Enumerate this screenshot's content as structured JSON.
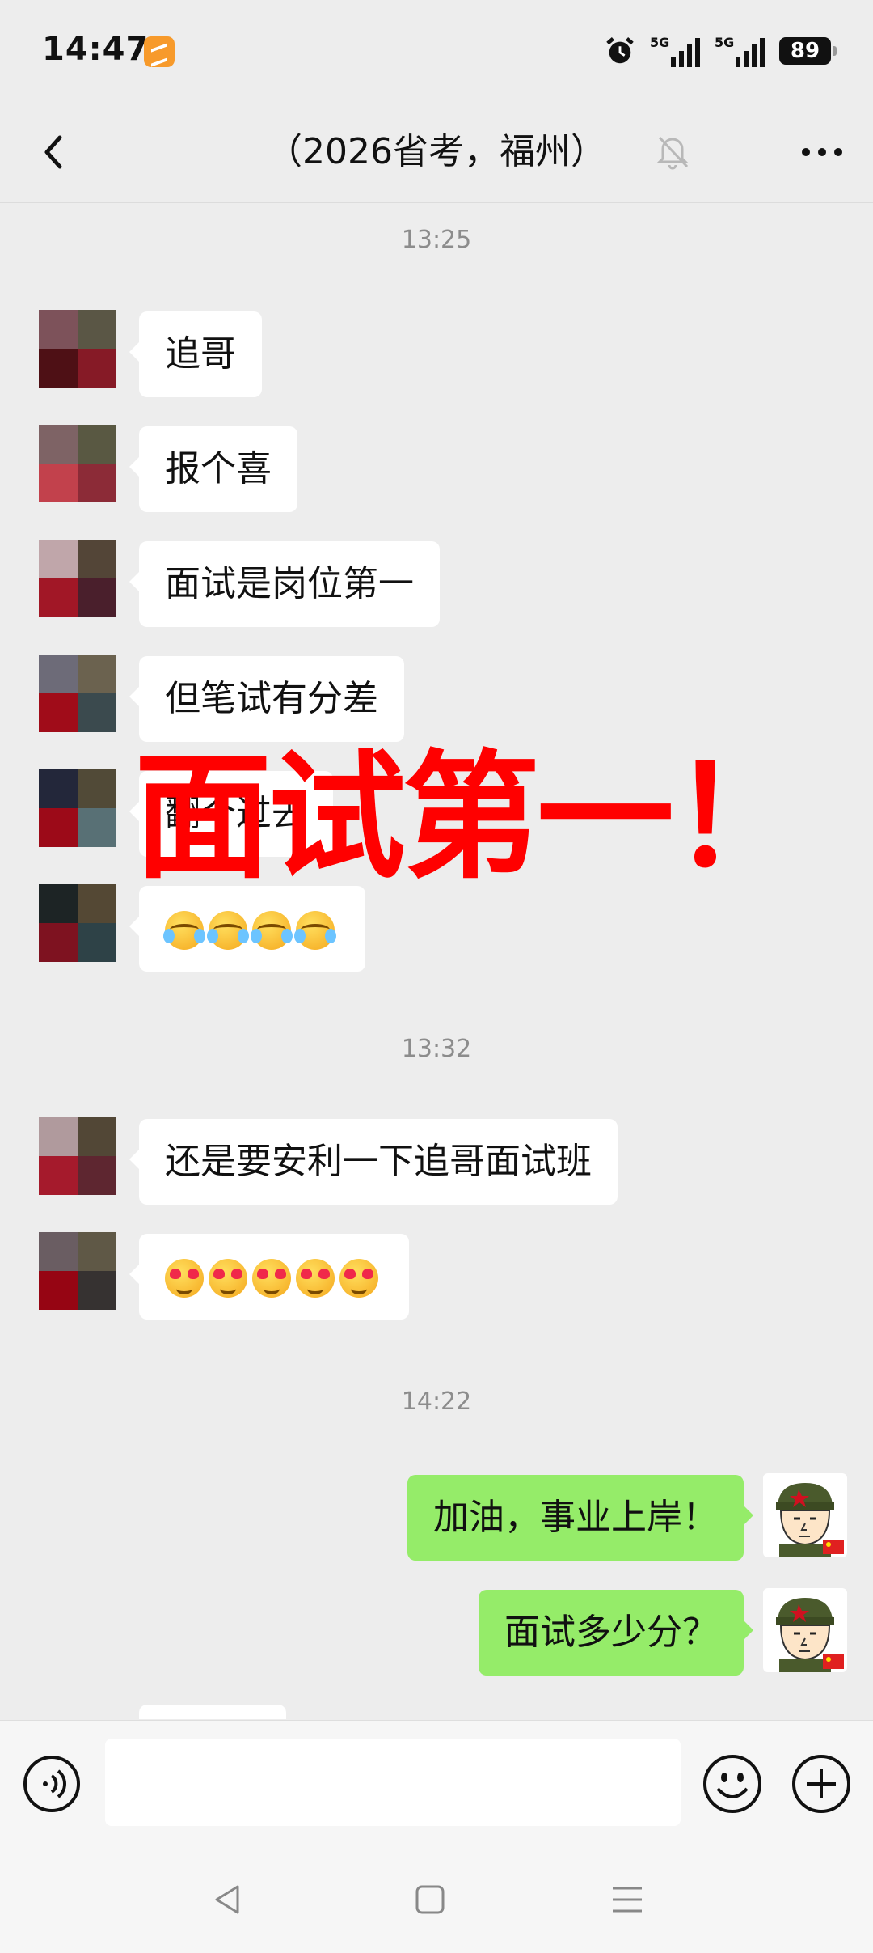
{
  "status_bar": {
    "time": "14:47",
    "signal1_label": "5G",
    "signal2_label": "5G",
    "battery": "89"
  },
  "nav": {
    "title": "（2026省考，福州）",
    "back_icon": "chevron-left-icon",
    "mute_icon": "bell-off-icon",
    "more_icon": "more-horizontal-icon"
  },
  "chat": {
    "timestamps": [
      "13:25",
      "13:32",
      "14:22"
    ],
    "messages": [
      {
        "sender": "other",
        "text": "追哥"
      },
      {
        "sender": "other",
        "text": "报个喜"
      },
      {
        "sender": "other",
        "text": "面试是岗位第一"
      },
      {
        "sender": "other",
        "text": "但笔试有分差"
      },
      {
        "sender": "other",
        "text": "翻个过去"
      },
      {
        "sender": "other",
        "emoji": "face-with-tears-icon",
        "count": 4
      },
      {
        "sender": "other",
        "text": "还是要安利一下追哥面试班"
      },
      {
        "sender": "other",
        "emoji": "smiling-face-with-heart-eyes-icon",
        "count": 5
      },
      {
        "sender": "me",
        "text": "加油，事业上岸！"
      },
      {
        "sender": "me",
        "text": "面试多少分？"
      }
    ]
  },
  "overlay_text": "面试第一！",
  "input_bar": {
    "value": "",
    "voice_icon": "voice-icon",
    "emoji_icon": "smile-icon",
    "plus_icon": "plus-icon"
  },
  "colors": {
    "background": "#ededed",
    "my_bubble": "#95ec69",
    "other_bubble": "#ffffff",
    "overlay": "#ff0000"
  }
}
